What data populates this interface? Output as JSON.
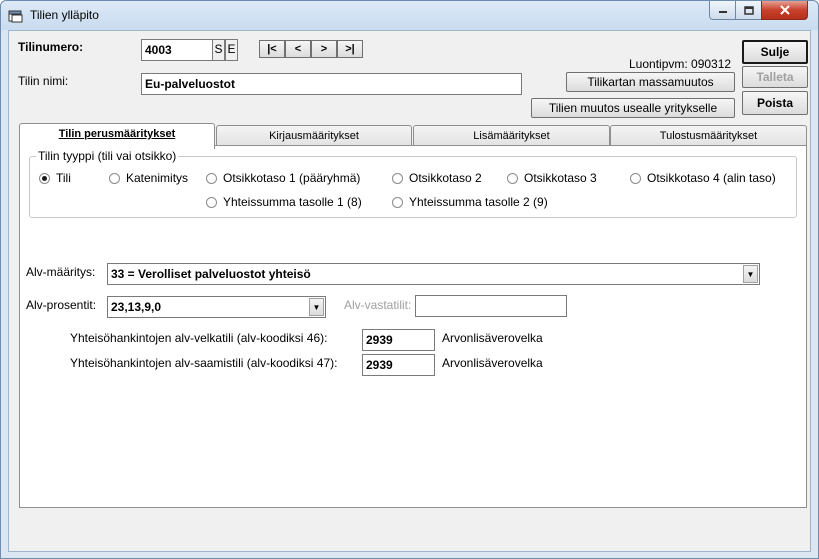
{
  "window": {
    "title": "Tilien ylläpito",
    "icon": "app-window-icon",
    "controls": [
      "minimize-icon",
      "maximize-icon",
      "close-icon"
    ]
  },
  "header": {
    "account_number_label": "Tilinumero:",
    "account_number_value": "4003",
    "s_label": "S",
    "e_label": "E",
    "nav": {
      "first": "|<",
      "prev": "<",
      "next": ">",
      "last": ">|"
    },
    "account_name_label": "Tilin nimi:",
    "account_name_value": "Eu-palveluostot",
    "created_date": "Luontipvm: 090312"
  },
  "buttons": {
    "close": "Sulje",
    "save": "Talleta",
    "delete": "Poista",
    "mass_change": "Tilikartan massamuutos",
    "multi_company": "Tilien muutos usealle yritykselle"
  },
  "tabs": [
    {
      "label": "Tilin perusmääritykset",
      "active": true
    },
    {
      "label": "Kirjausmääritykset",
      "active": false
    },
    {
      "label": "Lisämääritykset",
      "active": false
    },
    {
      "label": "Tulostusmääritykset",
      "active": false
    }
  ],
  "account_type": {
    "legend": "Tilin tyyppi (tili vai otsikko)",
    "options": [
      {
        "label": "Tili",
        "selected": true
      },
      {
        "label": "Katenimitys",
        "selected": false
      },
      {
        "label": "Otsikkotaso 1 (pääryhmä)",
        "selected": false
      },
      {
        "label": "Otsikkotaso 2",
        "selected": false
      },
      {
        "label": "Otsikkotaso 3",
        "selected": false
      },
      {
        "label": "Otsikkotaso 4 (alin taso)",
        "selected": false
      },
      {
        "label": "Yhteissumma tasolle 1 (8)",
        "selected": false
      },
      {
        "label": "Yhteissumma tasolle 2 (9)",
        "selected": false
      }
    ]
  },
  "vat": {
    "definition_label": "Alv-määritys:",
    "definition_value": "33 = Verolliset palveluostot yhteisö",
    "percentages_label": "Alv-prosentit:",
    "percentages_value": "23,13,9,0",
    "counter_accounts_label": "Alv-vastatilit:",
    "counter_accounts_value": "",
    "debt_label": "Yhteisöhankintojen alv-velkatili (alv-koodiksi 46):",
    "debt_value": "2939",
    "debt_desc": "Arvonlisäverovelka",
    "receivable_label": "Yhteisöhankintojen alv-saamistili (alv-koodiksi 47):",
    "receivable_value": "2939",
    "receivable_desc": "Arvonlisäverovelka"
  }
}
